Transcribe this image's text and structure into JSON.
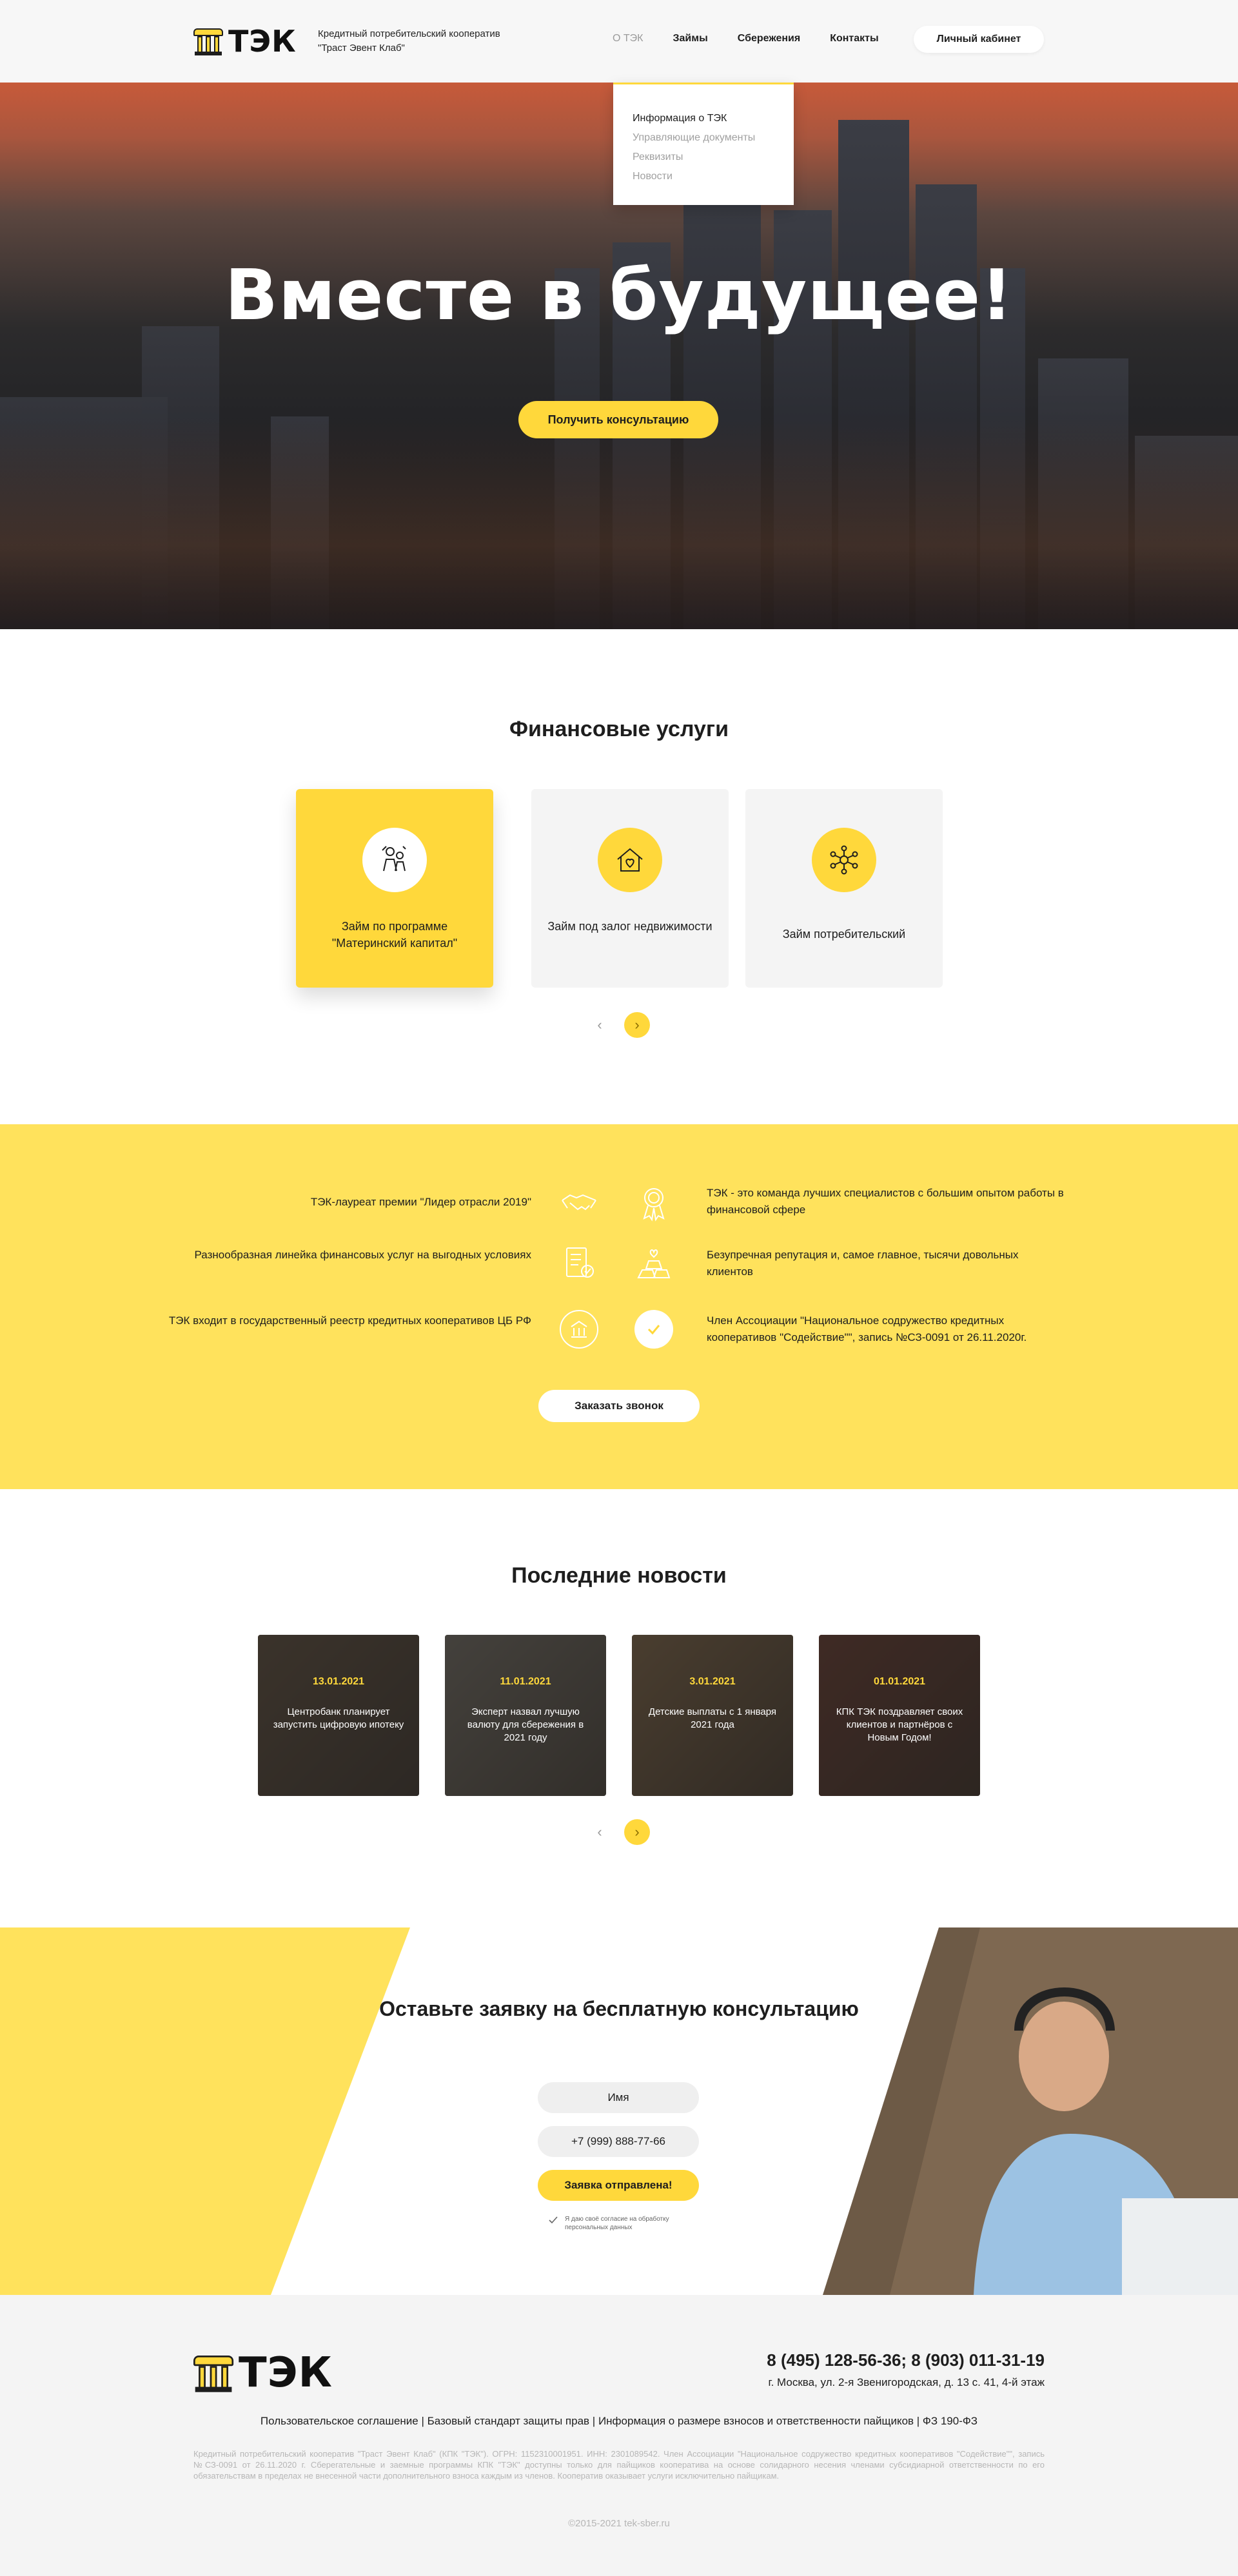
{
  "header": {
    "logo_text": "ТЭК",
    "subtitle": "Кредитный потребительский кооператив \"Траст Эвент Клаб\"",
    "nav": [
      "О ТЭК",
      "Займы",
      "Сбережения",
      "Контакты"
    ],
    "cabinet_label": "Личный кабинет",
    "dropdown": [
      "Информация о ТЭК",
      "Управляющие документы",
      "Реквизиты",
      "Новости"
    ]
  },
  "hero": {
    "title": "Вместе в будущее!",
    "button": "Получить консультацию"
  },
  "services": {
    "title": "Финансовые услуги",
    "cards": [
      {
        "label": "Займ по программе \"Материнский капитал\"",
        "icon": "family-icon",
        "active": true
      },
      {
        "label": "Займ под залог недвижимости",
        "icon": "house-heart-icon",
        "active": false
      },
      {
        "label": "Займ потребительский",
        "icon": "people-network-icon",
        "active": false
      }
    ]
  },
  "advantages": {
    "rows": [
      {
        "left": "ТЭК-лауреат премии \"Лидер отрасли 2019\"",
        "left_icon": "handshake-icon",
        "right_icon": "award-icon",
        "right": "ТЭК - это команда лучших специалистов с большим опытом работы в финансовой сфере"
      },
      {
        "left": "Разнообразная линейка финансовых услуг на выгодных условиях",
        "left_icon": "documents-icon",
        "right_icon": "gold-bars-icon",
        "right": "Безупречная репутация и, самое главное, тысячи довольных клиентов"
      },
      {
        "left": "ТЭК входит в государственный реестр кредитных кооперативов ЦБ РФ",
        "left_icon": "bank-emblem-icon",
        "right_icon": "check-icon",
        "right": "Член Ассоциации \"Национальное содружество кредитных кооперативов \"Содействие\"\", запись   №СЗ-0091 от 26.11.2020г."
      }
    ],
    "button": "Заказать звонок"
  },
  "news": {
    "title": "Последние новости",
    "items": [
      {
        "date": "13.01.2021",
        "title": "Центробанк планирует запустить цифровую ипотеку"
      },
      {
        "date": "11.01.2021",
        "title": "Эксперт назвал лучшую валюту для сбережения в 2021 году"
      },
      {
        "date": "3.01.2021",
        "title": "Детские выплаты с 1 января 2021 года"
      },
      {
        "date": "01.01.2021",
        "title": "КПК ТЭК поздравляет своих клиентов и партнёров с Новым Годом!"
      }
    ]
  },
  "consult": {
    "title": "Оставьте заявку на бесплатную консультацию",
    "name_field": "Имя",
    "phone_field": "+7 (999) 888-77-66",
    "submit": "Заявка отправлена!",
    "agree": "Я даю своё согласие на обработку персональных данных"
  },
  "footer": {
    "logo_text": "ТЭК",
    "phones": "8 (495) 128-56-36;   8 (903) 011-31-19",
    "address": "г. Москва, ул. 2-я Звенигородская, д. 13 с. 41, 4-й этаж",
    "links": "Пользовательское соглашение | Базовый стандарт защиты прав | Информация о размере взносов и ответственности пайщиков | ФЗ 190-ФЗ",
    "legal": "Кредитный потребительский кооператив \"Траст Эвент Клаб\" (КПК \"ТЭК\"). ОГРН: 1152310001951. ИНН: 2301089542. Член Ассоциации \"Национальное содружество кредитных кооперативов \"Содействие\"\", запись №СЗ-0091 от 26.11.2020 г. Сберегательные и заемные программы КПК \"ТЭК\" доступны только для пайщиков кооператива на основе солидарного несения членами субсидиарной ответственности по его обязательствам в пределах не внесенной части дополнительного взноса каждым из членов. Кооператив оказывает услуги исключительно пайщикам.",
    "copyright": "©2015-2021 tek-sber.ru"
  },
  "colors": {
    "accent": "#ffd83b",
    "band": "#ffe25c",
    "dark": "#1e1e1e"
  }
}
